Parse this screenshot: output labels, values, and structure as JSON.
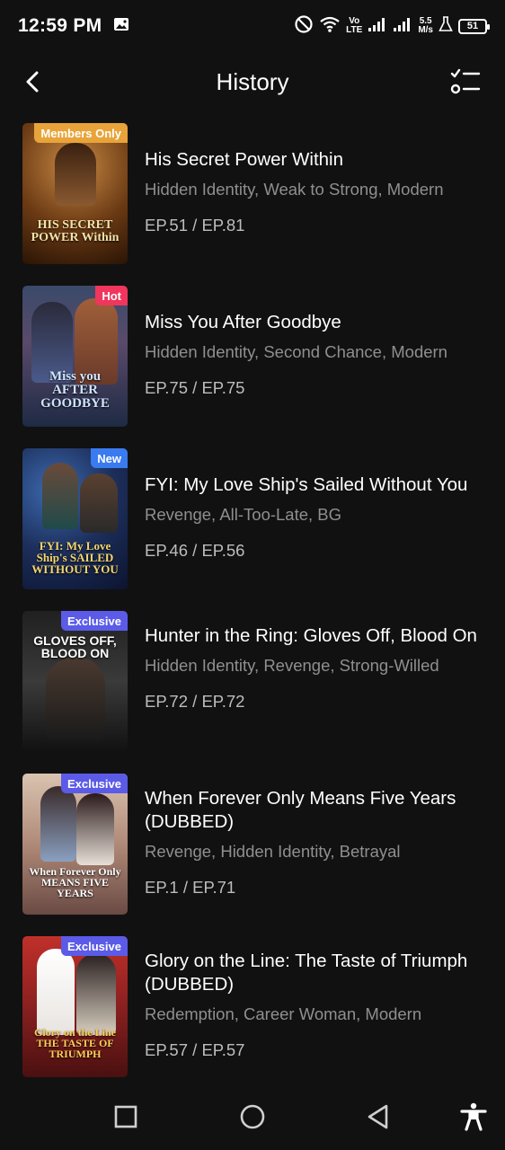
{
  "status_bar": {
    "time": "12:59 PM",
    "network_top": "Vo",
    "network_bottom": "LTE",
    "speed_top": "5.5",
    "speed_bottom": "M/s",
    "battery": "51"
  },
  "header": {
    "title": "History",
    "back_icon": "chevron-left-icon",
    "manage_icon": "checklist-icon"
  },
  "items": [
    {
      "title": "His Secret Power Within",
      "tags": "Hidden Identity, Weak to Strong, Modern",
      "episode": "EP.51",
      "total": "EP.81",
      "badge": "Members Only",
      "badge_color": "#e8a43a",
      "poster_text": "HIS SECRET POWER Within"
    },
    {
      "title": "Miss You After Goodbye",
      "tags": "Hidden Identity, Second Chance, Modern",
      "episode": "EP.75",
      "total": "EP.75",
      "badge": "Hot",
      "badge_color": "#f0365d",
      "poster_text": "Miss you AFTER GOODBYE"
    },
    {
      "title": "FYI: My Love Ship's Sailed Without You",
      "tags": "Revenge, All-Too-Late, BG",
      "episode": "EP.46",
      "total": "EP.56",
      "badge": "New",
      "badge_color": "#3a7bf0",
      "poster_text": "FYI: My Love Ship's SAILED WITHOUT YOU"
    },
    {
      "title": "Hunter in the Ring: Gloves Off, Blood On",
      "tags": "Hidden Identity, Revenge, Strong-Willed",
      "episode": "EP.72",
      "total": "EP.72",
      "badge": "Exclusive",
      "badge_color": "#5b5be8",
      "poster_text": "GLOVES OFF, BLOOD ON"
    },
    {
      "title": "When Forever Only Means Five Years (DUBBED)",
      "tags": "Revenge, Hidden Identity, Betrayal",
      "episode": "EP.1",
      "total": "EP.71",
      "badge": "Exclusive",
      "badge_color": "#5b5be8",
      "poster_text": "When Forever Only MEANS FIVE YEARS"
    },
    {
      "title": "Glory on the Line: The Taste of Triumph (DUBBED)",
      "tags": "Redemption, Career Woman, Modern",
      "episode": "EP.57",
      "total": "EP.57",
      "badge": "Exclusive",
      "badge_color": "#5b5be8",
      "poster_text": "Glory on the Line THE TASTE OF TRIUMPH"
    }
  ],
  "ep_separator": "/",
  "nav": {
    "recents_icon": "square-recents-icon",
    "home_icon": "circle-home-icon",
    "back_icon": "triangle-back-icon",
    "accessibility_icon": "accessibility-icon"
  }
}
